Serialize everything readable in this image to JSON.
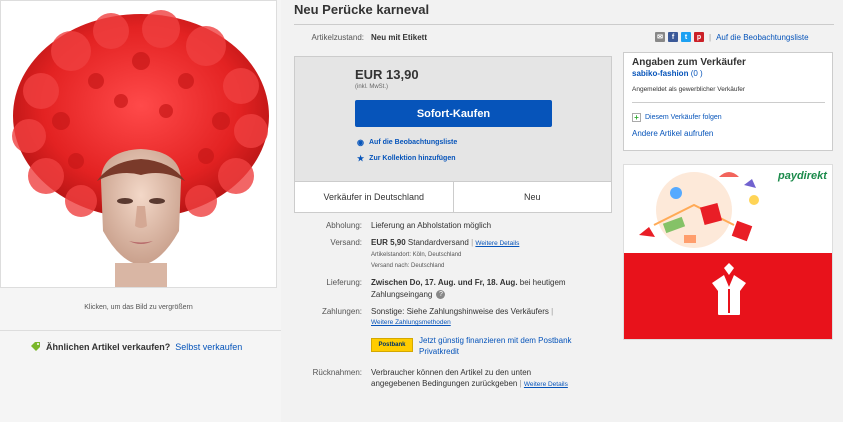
{
  "product": {
    "title": "Neu Perücke karneval",
    "image_caption": "Klicken, um das Bild zu vergrößern",
    "sell_question": "Ähnlichen Artikel verkaufen?",
    "sell_link": "Selbst verkaufen"
  },
  "condition": {
    "label": "Artikelzustand:",
    "value": "Neu mit Etikett"
  },
  "share": {
    "watch_link": "Auf die Beobachtungsliste",
    "icons": [
      "email-icon",
      "facebook-icon",
      "twitter-icon",
      "pinterest-icon"
    ]
  },
  "buy": {
    "price": "EUR 13,90",
    "price_note": "(inkl. MwSt.)",
    "buy_button": "Sofort-Kaufen",
    "watch_link": "Auf die Beobachtungsliste",
    "collection_link": "Zur Kollektion hinzufügen",
    "info_left": "Verkäufer in Deutschland",
    "info_right": "Neu"
  },
  "details": {
    "pickup_label": "Abholung:",
    "pickup_value": "Lieferung an Abholstation möglich",
    "shipping_label": "Versand:",
    "shipping_price": "EUR 5,90",
    "shipping_method": "Standardversand",
    "shipping_more": "Weitere Details",
    "location": "Artikelstandort: Köln, Deutschland",
    "ships_to": "Versand nach: Deutschland",
    "delivery_label": "Lieferung:",
    "delivery_dates": "Zwischen Do, 17. Aug. und Fr, 18. Aug.",
    "delivery_suffix": "bei heutigem",
    "delivery_line2": "Zahlungseingang",
    "payment_label": "Zahlungen:",
    "payment_value": "Sonstige: Siehe Zahlungshinweise des Verkäufers",
    "payment_more": "Weitere Zahlungsmethoden",
    "postbank_logo": "Postbank",
    "postbank_line1": "Jetzt günstig finanzieren mit dem Postbank",
    "postbank_line2": "Privatkredit",
    "returns_label": "Rücknahmen:",
    "returns_line1": "Verbraucher können den Artikel zu den unten",
    "returns_line2": "angegebenen Bedingungen zurückgeben",
    "returns_more": "Weitere Details"
  },
  "seller": {
    "heading": "Angaben zum Verkäufer",
    "name": "sabiko-fashion",
    "rating": "(0 )",
    "type": "Angemeldet als gewerblicher Verkäufer",
    "follow": "Diesem Verkäufer folgen",
    "other_items": "Andere Artikel aufrufen"
  },
  "ad": {
    "brand": "paydirekt"
  },
  "colors": {
    "link": "#0654ba",
    "buy_button": "#0654ba",
    "ad_red": "#e8121b",
    "wig_red": "#e32222"
  }
}
